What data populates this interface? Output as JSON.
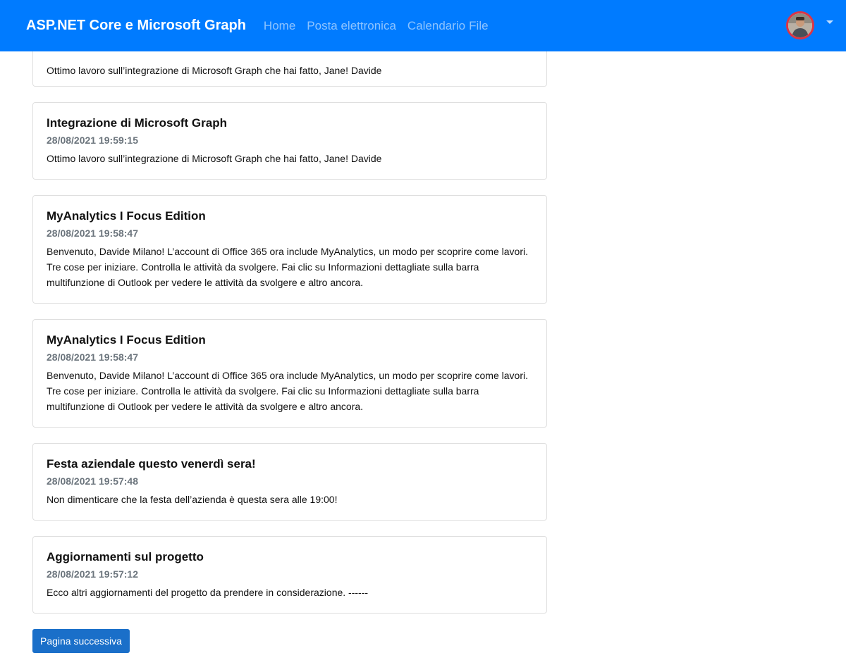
{
  "navbar": {
    "brand": "ASP.NET Core e Microsoft Graph",
    "links": [
      "Home",
      "Posta elettronica",
      "Calendario",
      "File"
    ]
  },
  "messages": [
    {
      "subject": "",
      "date": "",
      "body": "Ottimo lavoro sull’integrazione di Microsoft Graph che hai fatto, Jane! Davide"
    },
    {
      "subject": "Integrazione di Microsoft Graph",
      "date": "28/08/2021 19:59:15",
      "body": "Ottimo lavoro sull’integrazione di Microsoft Graph che hai fatto, Jane! Davide"
    },
    {
      "subject": "MyAnalytics I Focus Edition",
      "date": "28/08/2021 19:58:47",
      "body": "Benvenuto, Davide Milano! L’account di Office 365 ora include MyAnalytics, un modo per scoprire come lavori. Tre cose per iniziare. Controlla le attività da svolgere. Fai clic su Informazioni dettagliate sulla barra multifunzione di Outlook per vedere le attività da svolgere e altro ancora."
    },
    {
      "subject": "MyAnalytics I Focus Edition",
      "date": "28/08/2021 19:58:47",
      "body": "Benvenuto, Davide Milano! L’account di Office 365 ora include MyAnalytics, un modo per scoprire come lavori. Tre cose per iniziare. Controlla le attività da svolgere. Fai clic su Informazioni dettagliate sulla barra multifunzione di Outlook per vedere le attività da svolgere e altro ancora."
    },
    {
      "subject": "Festa aziendale questo venerdì sera!",
      "date": "28/08/2021 19:57:48",
      "body": "Non dimenticare che la festa dell’azienda è questa sera alle 19:00!"
    },
    {
      "subject": "Aggiornamenti sul progetto",
      "date": "28/08/2021 19:57:12",
      "body": "Ecco altri aggiornamenti del progetto da prendere in considerazione. ------"
    }
  ],
  "pagination": {
    "next_label": "Pagina successiva"
  },
  "colors": {
    "navbar": "#007bff",
    "button": "#1a6fc9",
    "avatar_border": "#dc3545"
  },
  "icons": {
    "user_menu": "user-avatar",
    "dropdown": "caret-down-icon"
  }
}
